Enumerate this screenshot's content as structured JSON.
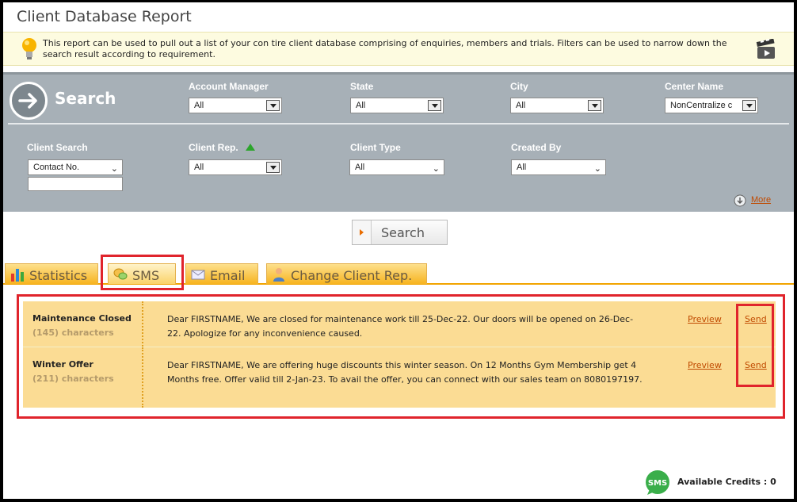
{
  "page": {
    "title": "Client Database Report"
  },
  "info": {
    "text": "This report can be used to pull out a list of your con tire client database comprising of enquiries, members and trials. Filters can be used to narrow down the search result according to requirement."
  },
  "search_panel": {
    "title": "Search",
    "filters": {
      "account_manager": {
        "label": "Account Manager",
        "value": "All"
      },
      "state": {
        "label": "State",
        "value": "All"
      },
      "city": {
        "label": "City",
        "value": "All"
      },
      "center_name": {
        "label": "Center Name",
        "value": "NonCentralize c"
      },
      "client_search": {
        "label": "Client Search",
        "value": "Contact No.",
        "input_value": ""
      },
      "client_rep": {
        "label": "Client Rep.",
        "value": "All"
      },
      "client_type": {
        "label": "Client Type",
        "value": "All"
      },
      "created_by": {
        "label": "Created By",
        "value": "All"
      }
    },
    "more_label": "More",
    "search_button": "Search"
  },
  "tabs": [
    {
      "label": "Statistics",
      "icon": "bar-chart-icon"
    },
    {
      "label": "SMS",
      "icon": "chat-bubbles-icon",
      "active": true
    },
    {
      "label": "Email",
      "icon": "envelope-icon"
    },
    {
      "label": "Change Client Rep.",
      "icon": "person-icon"
    }
  ],
  "messages": [
    {
      "name": "Maintenance Closed",
      "chars": "(145) characters",
      "body": "Dear FIRSTNAME, We are closed for maintenance work till 25-Dec-22. Our doors will be opened on 26-Dec-22. Apologize for any inconvenience caused.",
      "preview": "Preview",
      "send": "Send"
    },
    {
      "name": "Winter Offer",
      "chars": "(211) characters",
      "body": "Dear FIRSTNAME, We are offering huge discounts this winter season. On 12 Months Gym Membership get 4 Months free. Offer valid till 2-Jan-23. To avail the offer, you can connect with our sales team on 8080197197.",
      "preview": "Preview",
      "send": "Send"
    }
  ],
  "credits": {
    "badge": "SMS",
    "text": "Available Credits : 0"
  },
  "colors": {
    "accent": "#f7b420",
    "panel": "#a7b0b7",
    "highlight": "#e0242c",
    "link": "#c04a00"
  }
}
